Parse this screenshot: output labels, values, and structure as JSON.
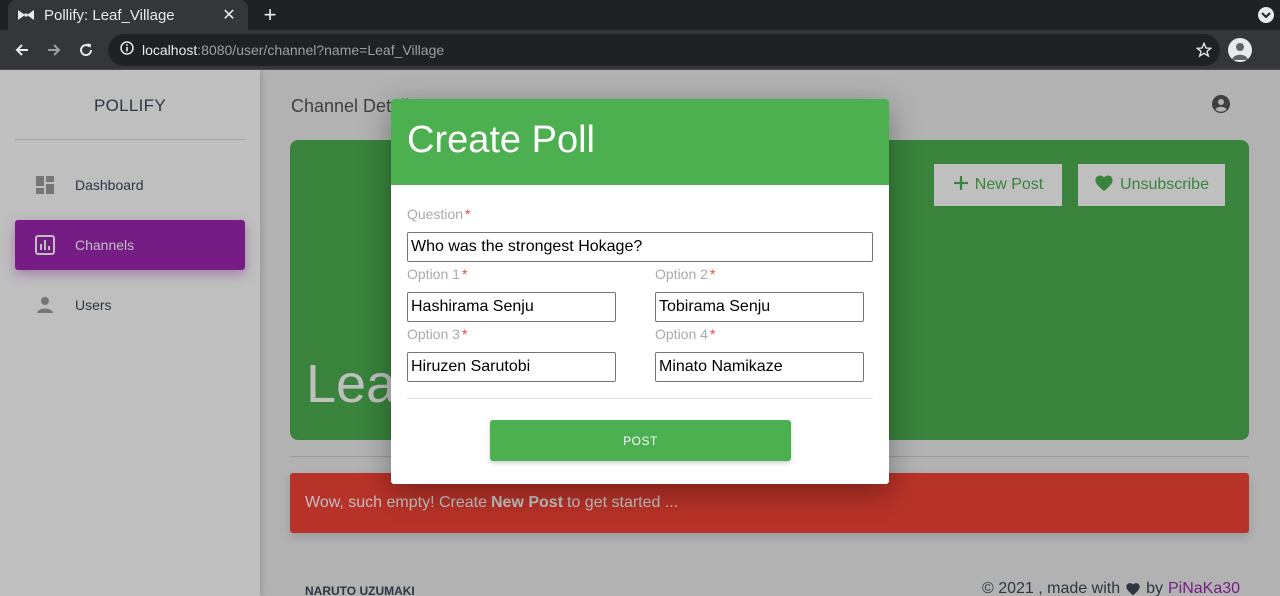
{
  "browser": {
    "tab_title": "Pollify: Leaf_Village",
    "tab_close": "✕",
    "new_tab": "+",
    "url_host": "localhost",
    "url_rest": ":8080/user/channel?name=Leaf_Village"
  },
  "sidebar": {
    "brand": "POLLIFY",
    "items": [
      {
        "label": "Dashboard",
        "icon": "dashboard-icon",
        "active": false
      },
      {
        "label": "Channels",
        "icon": "bar-chart-icon",
        "active": true
      },
      {
        "label": "Users",
        "icon": "person-icon",
        "active": false
      }
    ]
  },
  "main": {
    "title": "Channel Details",
    "channel_name": "Leaf_Village",
    "new_post_label": "New Post",
    "unsubscribe_label": "Unsubscribe",
    "empty_alert": {
      "prefix": "Wow, such empty! Create",
      "strong": "New Post",
      "suffix": "to get started ..."
    }
  },
  "footer": {
    "left": "NARUTO UZUMAKI",
    "right_prefix": "© 2021 , made with",
    "right_by": "by",
    "link": "PiNaKa30"
  },
  "modal": {
    "title": "Create Poll",
    "question_label": "Question",
    "question_value": "Who was the strongest Hokage?",
    "option1_label": "Option 1",
    "option1_value": "Hashirama Senju",
    "option2_label": "Option 2",
    "option2_value": "Tobirama Senju",
    "option3_label": "Option 3",
    "option3_value": "Hiruzen Sarutobi",
    "option4_label": "Option 4",
    "option4_value": "Minato Namikaze",
    "required_mark": "*",
    "post_label": "POST"
  },
  "colors": {
    "primary_green": "#4caf50",
    "active_purple": "#9c27b0",
    "alert_red": "#f44336"
  }
}
